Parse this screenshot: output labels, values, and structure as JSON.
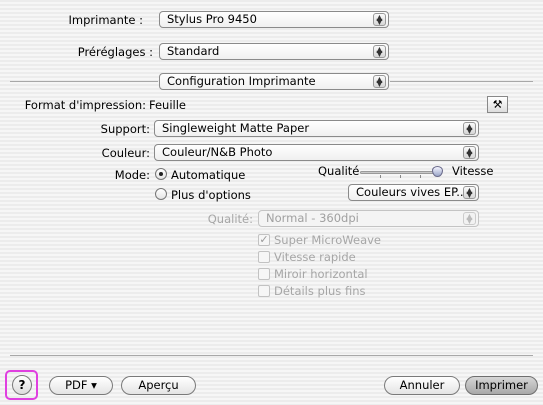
{
  "printer": {
    "label": "Imprimante :",
    "value": "Stylus Pro 9450"
  },
  "presets": {
    "label": "Préréglages :",
    "value": "Standard"
  },
  "panel": {
    "value": "Configuration Imprimante"
  },
  "print_format": {
    "label": "Format d'impression:",
    "value": "Feuille"
  },
  "support": {
    "label": "Support:",
    "value": "Singleweight Matte Paper"
  },
  "color": {
    "label": "Couleur:",
    "value": "Couleur/N&B Photo"
  },
  "mode": {
    "label": "Mode:",
    "automatic": "Automatique",
    "more_options": "Plus d'options",
    "quality_label": "Qualité",
    "speed_label": "Vitesse",
    "slider_level": 1.0,
    "color_mode": "Couleurs vives EP..."
  },
  "advanced": {
    "quality_label": "Qualité:",
    "quality_value": "Normal - 360dpi",
    "options": [
      {
        "label": "Super MicroWeave",
        "checked": true
      },
      {
        "label": "Vitesse rapide",
        "checked": false
      },
      {
        "label": "Miroir horizontal",
        "checked": false
      },
      {
        "label": "Détails plus fins",
        "checked": false
      }
    ]
  },
  "footer": {
    "help": "?",
    "pdf": "PDF ▾",
    "preview": "Aperçu",
    "cancel": "Annuler",
    "print": "Imprimer"
  },
  "colors": {
    "highlight": "#e040e0"
  }
}
